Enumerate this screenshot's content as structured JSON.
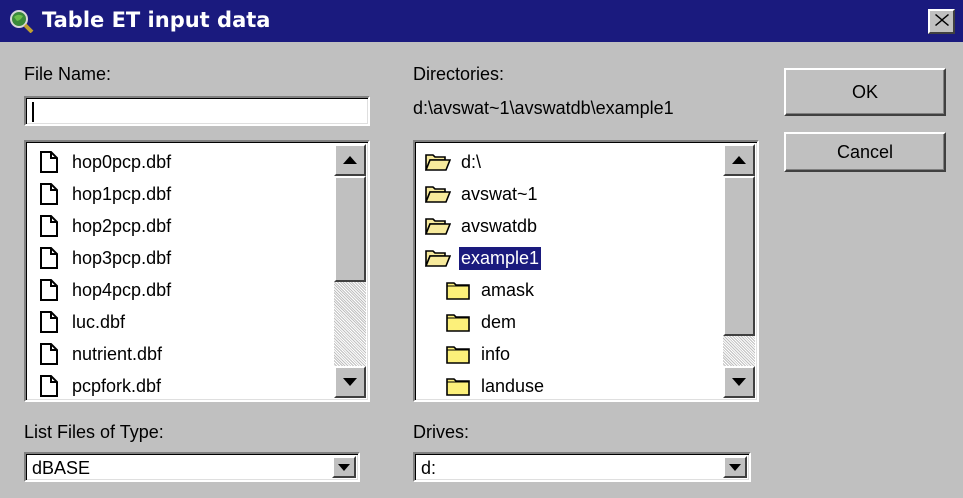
{
  "window": {
    "title": "Table ET input data",
    "close_icon": "close-icon"
  },
  "file_name": {
    "label": "File Name:",
    "value": ""
  },
  "files": {
    "items": [
      {
        "name": "hop0pcp.dbf",
        "icon": "document-icon"
      },
      {
        "name": "hop1pcp.dbf",
        "icon": "document-icon"
      },
      {
        "name": "hop2pcp.dbf",
        "icon": "document-icon"
      },
      {
        "name": "hop3pcp.dbf",
        "icon": "document-icon"
      },
      {
        "name": "hop4pcp.dbf",
        "icon": "document-icon"
      },
      {
        "name": "luc.dbf",
        "icon": "document-icon"
      },
      {
        "name": "nutrient.dbf",
        "icon": "document-icon"
      },
      {
        "name": "pcpfork.dbf",
        "icon": "document-icon"
      }
    ]
  },
  "directories": {
    "label": "Directories:",
    "path": "d:\\avswat~1\\avswatdb\\example1",
    "items": [
      {
        "name": "d:\\",
        "icon": "open-folder-icon",
        "selected": false
      },
      {
        "name": "avswat~1",
        "icon": "open-folder-icon",
        "selected": false
      },
      {
        "name": "avswatdb",
        "icon": "open-folder-icon",
        "selected": false
      },
      {
        "name": "example1",
        "icon": "open-folder-icon",
        "selected": true
      },
      {
        "name": "amask",
        "icon": "folder-icon",
        "selected": false
      },
      {
        "name": "dem",
        "icon": "folder-icon",
        "selected": false
      },
      {
        "name": "info",
        "icon": "folder-icon",
        "selected": false
      },
      {
        "name": "landuse",
        "icon": "folder-icon",
        "selected": false
      }
    ]
  },
  "buttons": {
    "ok": "OK",
    "cancel": "Cancel"
  },
  "file_type": {
    "label": "List Files of Type:",
    "value": "dBASE"
  },
  "drives": {
    "label": "Drives:",
    "value": "d:"
  },
  "colors": {
    "title_bar": "#1a1a7e",
    "face": "#c0c0c0",
    "selection": "#1a1a7e"
  }
}
